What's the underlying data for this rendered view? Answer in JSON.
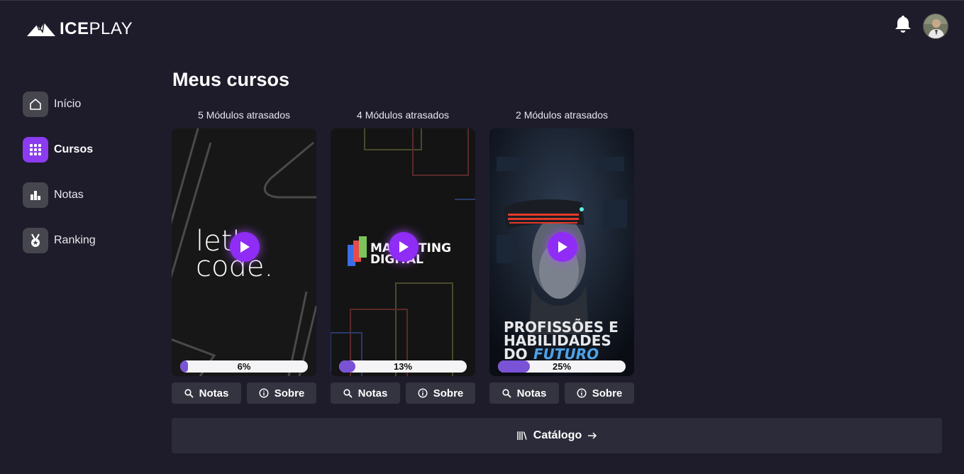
{
  "brand": {
    "part1": "ICE",
    "part2": "PLAY"
  },
  "header": {
    "notifications_icon": "bell-icon",
    "avatar_icon": "avatar"
  },
  "sidebar": {
    "items": [
      {
        "label": "Início",
        "icon": "home-icon",
        "active": false
      },
      {
        "label": "Cursos",
        "icon": "grid-icon",
        "active": true
      },
      {
        "label": "Notas",
        "icon": "bar-chart-icon",
        "active": false
      },
      {
        "label": "Ranking",
        "icon": "medal-icon",
        "active": false
      }
    ]
  },
  "main": {
    "title": "Meus cursos",
    "courses": [
      {
        "late": "5 Módulos atrasados",
        "progress": 6,
        "progress_label": "6%",
        "art_line1": "let's",
        "art_line2": "code."
      },
      {
        "late": "4 Módulos atrasados",
        "progress": 13,
        "progress_label": "13%",
        "art_line1": "MARKETING",
        "art_line2": "DIGITAL"
      },
      {
        "late": "2 Módulos atrasados",
        "progress": 25,
        "progress_label": "25%",
        "art_line1": "PROFISSÕES E",
        "art_line2": "HABILIDADES",
        "art_line3": "DO",
        "art_line4": "FUTURO"
      }
    ],
    "buttons": {
      "notes": "Notas",
      "about": "Sobre"
    },
    "catalog": {
      "label": "Catálogo"
    }
  },
  "colors": {
    "background": "#1e1c2b",
    "accent": "#8b3cf0",
    "progress": "#7a52d6",
    "button": "#343340"
  }
}
